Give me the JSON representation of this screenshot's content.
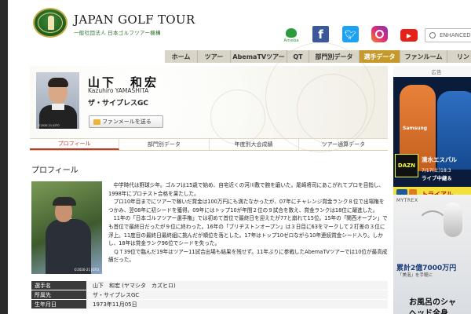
{
  "header": {
    "logo_title": "JAPAN GOLF TOUR",
    "logo_subtitle": "一般社団法人 日本ゴルフツアー機構",
    "ameba_label": "Ameba",
    "search_placeholder": "ENHANCED"
  },
  "nav": {
    "items": [
      {
        "label": "ホーム"
      },
      {
        "label": "ツアー"
      },
      {
        "label": "AbemaTVツアー"
      },
      {
        "label": "QT"
      },
      {
        "label": "部門別データ"
      },
      {
        "label": "選手データ",
        "active": true
      },
      {
        "label": "ファンルーム"
      },
      {
        "label": "リン"
      }
    ]
  },
  "player": {
    "name": "山下　和宏",
    "roman": "Kazuhiro YAMASHITA",
    "team": "ザ・サイプレスGC",
    "photo_credit": "©2020-21 JGTO",
    "fan_mail_button": "ファンメールを送る"
  },
  "tabs": [
    {
      "label": "プロフィール",
      "active": true
    },
    {
      "label": "部門別データ"
    },
    {
      "label": "年度別大会成績"
    },
    {
      "label": "ツアー通算データ"
    }
  ],
  "profile": {
    "section_title": "プロフィール",
    "photo_credit": "©2020-21 JGTO",
    "bio": [
      "中学時代は野球少年。ゴルフは15歳で始め、自宅近くの河川敷で腕を磨いた。尾崎将司にあこがれてプロを目指し、1998年にプロテスト合格を果たした。",
      "プロ10年目までにツアーで稼いだ賞金は100万円にも満たなかったが、07年にチャレンジ賞金ランク８位で出場権をつかみ、翌08年に初シードを獲得。09年にはトップ10が年間２位の９試合を数え、賞金ランクは18位に躍進した。",
      "11年の「日本ゴルフツアー選手権」では初めて首位で最終日を迎えたが77と崩れて15位。15年の「関西オープン」でも首位で最終日だったが９位に終わった。16年の「ブリヂストンオープン」は３日目に63をマークして２打差の３位に浮上。11度目の最終日最終組に挑んだが順位を落とした。17年はトップ10ゼロながら10年連続賞金シード入り。しかし、18年は賞金ランク96位でシードを失った。",
      "ＱＴ39位で臨んだ19年はツアー11試合出場も結果を残せず。11年ぶりに参戦したAbemaTVツアーでは10位が最高成績だった。"
    ]
  },
  "details": [
    {
      "label": "選手名",
      "value": "山下　和宏 (ヤマシタ　カズヒロ)"
    },
    {
      "label": "所属先",
      "value": "ザ・サイプレスGC"
    },
    {
      "label": "生年月日",
      "value": "1973年11月05日"
    }
  ],
  "ads": {
    "label": "広告",
    "ad1": {
      "brand": "Samsung",
      "dazn": "DAZN",
      "line1": "清水エスパル",
      "line2": "7/17(土)18:3",
      "line3": "ライブ中継＆",
      "cta": "トライアル"
    },
    "ad2": {
      "brand": "MYTREX",
      "line1": "累計2億7000万円",
      "line2": "「美泡」を手軽に",
      "line3": "お風呂のシャ",
      "line4": "ヘッド全身"
    }
  },
  "colors": {
    "nav_active": "#c69a2a",
    "tab_active": "#c0392b",
    "table_label_bg": "#3a3a3a"
  }
}
